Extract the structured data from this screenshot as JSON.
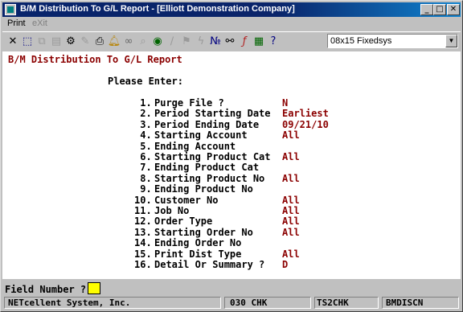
{
  "window": {
    "title": "B/M Distribution To G/L Report - [Elliott Demonstration Company]",
    "controls": {
      "minimize": "_",
      "maximize": "□",
      "close": "✕"
    }
  },
  "menu": {
    "print": "Print",
    "exit": "eXit"
  },
  "toolbar": {
    "font": "08x15 Fixedsys"
  },
  "report": {
    "title": "B/M Distribution To G/L Report",
    "prompt": "Please Enter:",
    "fields": [
      {
        "num": " 1.",
        "label": "Purge File ?",
        "value": "N"
      },
      {
        "num": " 2.",
        "label": "Period Starting Date",
        "value": "Earliest"
      },
      {
        "num": " 3.",
        "label": "Period Ending Date",
        "value": "09/21/10"
      },
      {
        "num": " 4.",
        "label": "Starting Account",
        "value": "All"
      },
      {
        "num": " 5.",
        "label": "Ending Account",
        "value": ""
      },
      {
        "num": " 6.",
        "label": "Starting Product Cat",
        "value": "All"
      },
      {
        "num": " 7.",
        "label": "Ending Product Cat",
        "value": ""
      },
      {
        "num": " 8.",
        "label": "Starting Product No",
        "value": "All"
      },
      {
        "num": " 9.",
        "label": "Ending Product No",
        "value": ""
      },
      {
        "num": "10.",
        "label": "Customer No",
        "value": "All"
      },
      {
        "num": "11.",
        "label": "Job No",
        "value": "All"
      },
      {
        "num": "12.",
        "label": "Order Type",
        "value": "All"
      },
      {
        "num": "13.",
        "label": "Starting Order No",
        "value": "All"
      },
      {
        "num": "14.",
        "label": "Ending Order No",
        "value": ""
      },
      {
        "num": "15.",
        "label": "Print Dist Type",
        "value": "All"
      },
      {
        "num": "16.",
        "label": "Detail Or Summary ?",
        "value": "D"
      }
    ]
  },
  "command": {
    "label": "Field Number ?"
  },
  "status": {
    "company": "NETcellent System, Inc.",
    "checks": "030 CHK",
    "terminal": "TS2CHK",
    "program": "BMDISCN"
  }
}
